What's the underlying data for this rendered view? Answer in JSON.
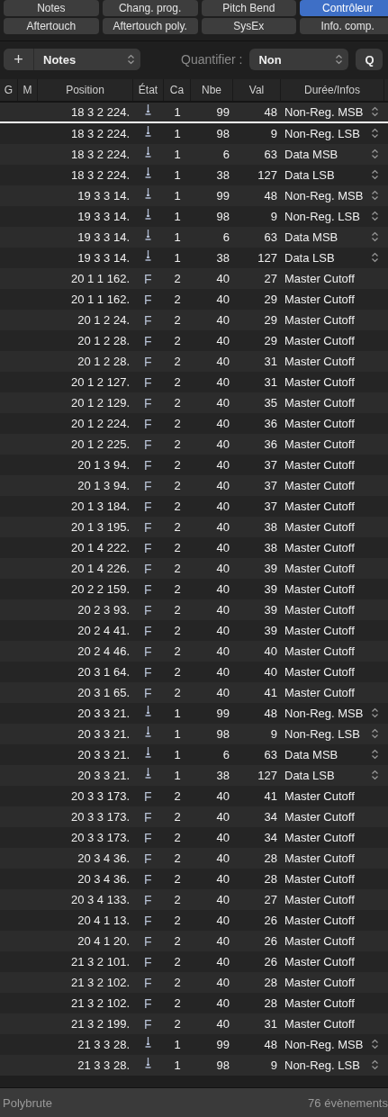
{
  "filters": [
    {
      "label": "Notes",
      "selected": false
    },
    {
      "label": "Chang. prog.",
      "selected": false
    },
    {
      "label": "Pitch Bend",
      "selected": false
    },
    {
      "label": "Contrôleur",
      "selected": true
    },
    {
      "label": "Aftertouch",
      "selected": false
    },
    {
      "label": "Aftertouch poly.",
      "selected": false
    },
    {
      "label": "SysEx",
      "selected": false
    },
    {
      "label": "Info. comp.",
      "selected": false
    }
  ],
  "toolbar": {
    "add": "+",
    "type_menu": "Notes",
    "quantize_label": "Quantifier :",
    "quantize_menu": "Non",
    "q_button": "Q"
  },
  "columns": [
    "G",
    "M",
    "Position",
    "État",
    "Ca",
    "Nbe",
    "Val",
    "Durée/Infos"
  ],
  "rows": [
    {
      "position": "18 3 2 224.",
      "kind": "fader",
      "ch": "1",
      "num": "99",
      "val": "48",
      "info": "Non-Reg. MSB",
      "playhead": true
    },
    {
      "position": "18 3 2 224.",
      "kind": "fader",
      "ch": "1",
      "num": "98",
      "val": "9",
      "info": "Non-Reg. LSB",
      "playhead": false
    },
    {
      "position": "18 3 2 224.",
      "kind": "fader",
      "ch": "1",
      "num": "6",
      "val": "63",
      "info": "Data MSB",
      "playhead": false
    },
    {
      "position": "18 3 2 224.",
      "kind": "fader",
      "ch": "1",
      "num": "38",
      "val": "127",
      "info": "Data LSB",
      "playhead": false
    },
    {
      "position": "19 3 3 14.",
      "kind": "fader",
      "ch": "1",
      "num": "99",
      "val": "48",
      "info": "Non-Reg. MSB",
      "playhead": false
    },
    {
      "position": "19 3 3 14.",
      "kind": "fader",
      "ch": "1",
      "num": "98",
      "val": "9",
      "info": "Non-Reg. LSB",
      "playhead": false
    },
    {
      "position": "19 3 3 14.",
      "kind": "fader",
      "ch": "1",
      "num": "6",
      "val": "63",
      "info": "Data MSB",
      "playhead": false
    },
    {
      "position": "19 3 3 14.",
      "kind": "fader",
      "ch": "1",
      "num": "38",
      "val": "127",
      "info": "Data LSB",
      "playhead": false
    },
    {
      "position": "20 1 1 162.",
      "kind": "text",
      "status": "F",
      "ch": "2",
      "num": "40",
      "val": "27",
      "info": "Master Cutoff",
      "playhead": false
    },
    {
      "position": "20 1 1 162.",
      "kind": "text",
      "status": "F",
      "ch": "2",
      "num": "40",
      "val": "29",
      "info": "Master Cutoff",
      "playhead": false
    },
    {
      "position": "20 1 2 24.",
      "kind": "text",
      "status": "F",
      "ch": "2",
      "num": "40",
      "val": "29",
      "info": "Master Cutoff",
      "playhead": false
    },
    {
      "position": "20 1 2 28.",
      "kind": "text",
      "status": "F",
      "ch": "2",
      "num": "40",
      "val": "29",
      "info": "Master Cutoff",
      "playhead": false
    },
    {
      "position": "20 1 2 28.",
      "kind": "text",
      "status": "F",
      "ch": "2",
      "num": "40",
      "val": "31",
      "info": "Master Cutoff",
      "playhead": false
    },
    {
      "position": "20 1 2 127.",
      "kind": "text",
      "status": "F",
      "ch": "2",
      "num": "40",
      "val": "31",
      "info": "Master Cutoff",
      "playhead": false
    },
    {
      "position": "20 1 2 129.",
      "kind": "text",
      "status": "F",
      "ch": "2",
      "num": "40",
      "val": "35",
      "info": "Master Cutoff",
      "playhead": false
    },
    {
      "position": "20 1 2 224.",
      "kind": "text",
      "status": "F",
      "ch": "2",
      "num": "40",
      "val": "36",
      "info": "Master Cutoff",
      "playhead": false
    },
    {
      "position": "20 1 2 225.",
      "kind": "text",
      "status": "F",
      "ch": "2",
      "num": "40",
      "val": "36",
      "info": "Master Cutoff",
      "playhead": false
    },
    {
      "position": "20 1 3 94.",
      "kind": "text",
      "status": "F",
      "ch": "2",
      "num": "40",
      "val": "37",
      "info": "Master Cutoff",
      "playhead": false
    },
    {
      "position": "20 1 3 94.",
      "kind": "text",
      "status": "F",
      "ch": "2",
      "num": "40",
      "val": "37",
      "info": "Master Cutoff",
      "playhead": false
    },
    {
      "position": "20 1 3 184.",
      "kind": "text",
      "status": "F",
      "ch": "2",
      "num": "40",
      "val": "37",
      "info": "Master Cutoff",
      "playhead": false
    },
    {
      "position": "20 1 3 195.",
      "kind": "text",
      "status": "F",
      "ch": "2",
      "num": "40",
      "val": "38",
      "info": "Master Cutoff",
      "playhead": false
    },
    {
      "position": "20 1 4 222.",
      "kind": "text",
      "status": "F",
      "ch": "2",
      "num": "40",
      "val": "38",
      "info": "Master Cutoff",
      "playhead": false
    },
    {
      "position": "20 1 4 226.",
      "kind": "text",
      "status": "F",
      "ch": "2",
      "num": "40",
      "val": "39",
      "info": "Master Cutoff",
      "playhead": false
    },
    {
      "position": "20 2 2 159.",
      "kind": "text",
      "status": "F",
      "ch": "2",
      "num": "40",
      "val": "39",
      "info": "Master Cutoff",
      "playhead": false
    },
    {
      "position": "20 2 3 93.",
      "kind": "text",
      "status": "F",
      "ch": "2",
      "num": "40",
      "val": "39",
      "info": "Master Cutoff",
      "playhead": false
    },
    {
      "position": "20 2 4 41.",
      "kind": "text",
      "status": "F",
      "ch": "2",
      "num": "40",
      "val": "39",
      "info": "Master Cutoff",
      "playhead": false
    },
    {
      "position": "20 2 4 46.",
      "kind": "text",
      "status": "F",
      "ch": "2",
      "num": "40",
      "val": "40",
      "info": "Master Cutoff",
      "playhead": false
    },
    {
      "position": "20 3 1 64.",
      "kind": "text",
      "status": "F",
      "ch": "2",
      "num": "40",
      "val": "40",
      "info": "Master Cutoff",
      "playhead": false
    },
    {
      "position": "20 3 1 65.",
      "kind": "text",
      "status": "F",
      "ch": "2",
      "num": "40",
      "val": "41",
      "info": "Master Cutoff",
      "playhead": false
    },
    {
      "position": "20 3 3 21.",
      "kind": "fader",
      "ch": "1",
      "num": "99",
      "val": "48",
      "info": "Non-Reg. MSB",
      "playhead": false
    },
    {
      "position": "20 3 3 21.",
      "kind": "fader",
      "ch": "1",
      "num": "98",
      "val": "9",
      "info": "Non-Reg. LSB",
      "playhead": false
    },
    {
      "position": "20 3 3 21.",
      "kind": "fader",
      "ch": "1",
      "num": "6",
      "val": "63",
      "info": "Data MSB",
      "playhead": false
    },
    {
      "position": "20 3 3 21.",
      "kind": "fader",
      "ch": "1",
      "num": "38",
      "val": "127",
      "info": "Data LSB",
      "playhead": false
    },
    {
      "position": "20 3 3 173.",
      "kind": "text",
      "status": "F",
      "ch": "2",
      "num": "40",
      "val": "41",
      "info": "Master Cutoff",
      "playhead": false
    },
    {
      "position": "20 3 3 173.",
      "kind": "text",
      "status": "F",
      "ch": "2",
      "num": "40",
      "val": "34",
      "info": "Master Cutoff",
      "playhead": false
    },
    {
      "position": "20 3 3 173.",
      "kind": "text",
      "status": "F",
      "ch": "2",
      "num": "40",
      "val": "34",
      "info": "Master Cutoff",
      "playhead": false
    },
    {
      "position": "20 3 4 36.",
      "kind": "text",
      "status": "F",
      "ch": "2",
      "num": "40",
      "val": "28",
      "info": "Master Cutoff",
      "playhead": false
    },
    {
      "position": "20 3 4 36.",
      "kind": "text",
      "status": "F",
      "ch": "2",
      "num": "40",
      "val": "28",
      "info": "Master Cutoff",
      "playhead": false
    },
    {
      "position": "20 3 4 133.",
      "kind": "text",
      "status": "F",
      "ch": "2",
      "num": "40",
      "val": "27",
      "info": "Master Cutoff",
      "playhead": false
    },
    {
      "position": "20 4 1 13.",
      "kind": "text",
      "status": "F",
      "ch": "2",
      "num": "40",
      "val": "26",
      "info": "Master Cutoff",
      "playhead": false
    },
    {
      "position": "20 4 1 20.",
      "kind": "text",
      "status": "F",
      "ch": "2",
      "num": "40",
      "val": "26",
      "info": "Master Cutoff",
      "playhead": false
    },
    {
      "position": "21 3 2 101.",
      "kind": "text",
      "status": "F",
      "ch": "2",
      "num": "40",
      "val": "26",
      "info": "Master Cutoff",
      "playhead": false
    },
    {
      "position": "21 3 2 102.",
      "kind": "text",
      "status": "F",
      "ch": "2",
      "num": "40",
      "val": "28",
      "info": "Master Cutoff",
      "playhead": false
    },
    {
      "position": "21 3 2 102.",
      "kind": "text",
      "status": "F",
      "ch": "2",
      "num": "40",
      "val": "28",
      "info": "Master Cutoff",
      "playhead": false
    },
    {
      "position": "21 3 2 199.",
      "kind": "text",
      "status": "F",
      "ch": "2",
      "num": "40",
      "val": "31",
      "info": "Master Cutoff",
      "playhead": false
    },
    {
      "position": "21 3 3 28.",
      "kind": "fader",
      "ch": "1",
      "num": "99",
      "val": "48",
      "info": "Non-Reg. MSB",
      "playhead": false
    },
    {
      "position": "21 3 3 28.",
      "kind": "fader",
      "ch": "1",
      "num": "98",
      "val": "9",
      "info": "Non-Reg. LSB",
      "playhead": false
    }
  ],
  "status_bar": {
    "instrument": "Polybrute",
    "count": "76 évènements"
  }
}
